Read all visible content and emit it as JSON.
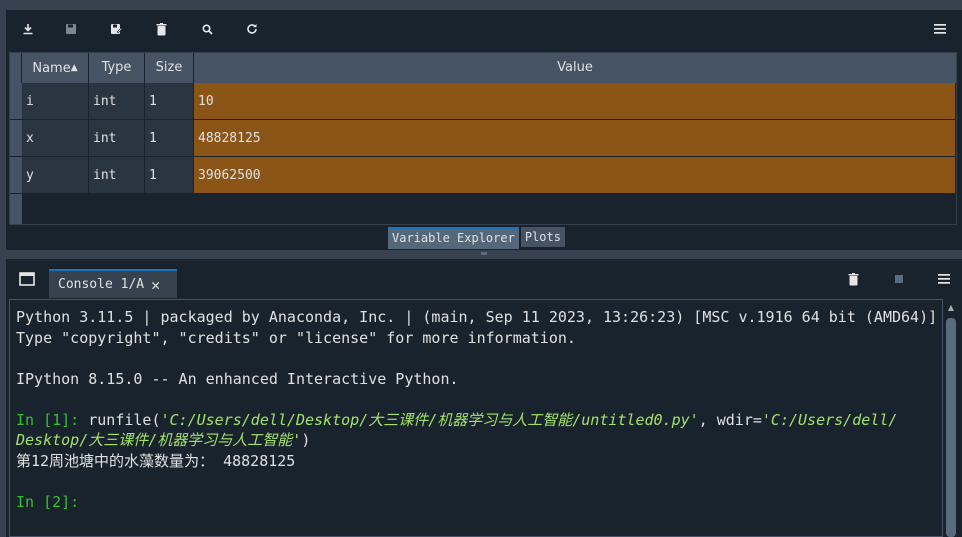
{
  "variable_explorer": {
    "columns": [
      "Name",
      "Type",
      "Size",
      "Value"
    ],
    "rows": [
      {
        "name": "i",
        "type": "int",
        "size": "1",
        "value": "10"
      },
      {
        "name": "x",
        "type": "int",
        "size": "1",
        "value": "48828125"
      },
      {
        "name": "y",
        "type": "int",
        "size": "1",
        "value": "39062500"
      }
    ],
    "sort_indicator": "▲",
    "toolbar_icons": [
      "import-data-icon",
      "save-icon",
      "save-as-icon",
      "clear-icon",
      "search-icon",
      "refresh-icon",
      "menu-icon"
    ]
  },
  "bottom_tabs": [
    "Variable Explorer",
    "Plots"
  ],
  "console": {
    "tab_label": "Console 1/A",
    "lines": {
      "l1": "Python 3.11.5 | packaged by Anaconda, Inc. | (main, Sep 11 2023, 13:26:23) [MSC v.1916 64 bit (AMD64)]",
      "l2": "Type \"copyright\", \"credits\" or \"license\" for more information.",
      "l3": "IPython 8.15.0 -- An enhanced Interactive Python.",
      "in1": "In [1]:",
      "runfile_a": " runfile(",
      "path_a": "'C:/Users/dell/Desktop/大三课件/机器学习与人工智能/untitled0.py'",
      "wdir": ", wdir=",
      "path_b1": "'C:/Users/dell/",
      "path_b2": "Desktop/大三课件/机器学习与人工智能'",
      "close_paren": ")",
      "output": "第12周池塘中的水藻数量为： 48828125",
      "in2": "In [2]:"
    }
  },
  "colors": {
    "value_cell": "#8b5518",
    "prompt": "#34c22c",
    "string": "#a2e26a",
    "accent": "#1a72bb"
  }
}
